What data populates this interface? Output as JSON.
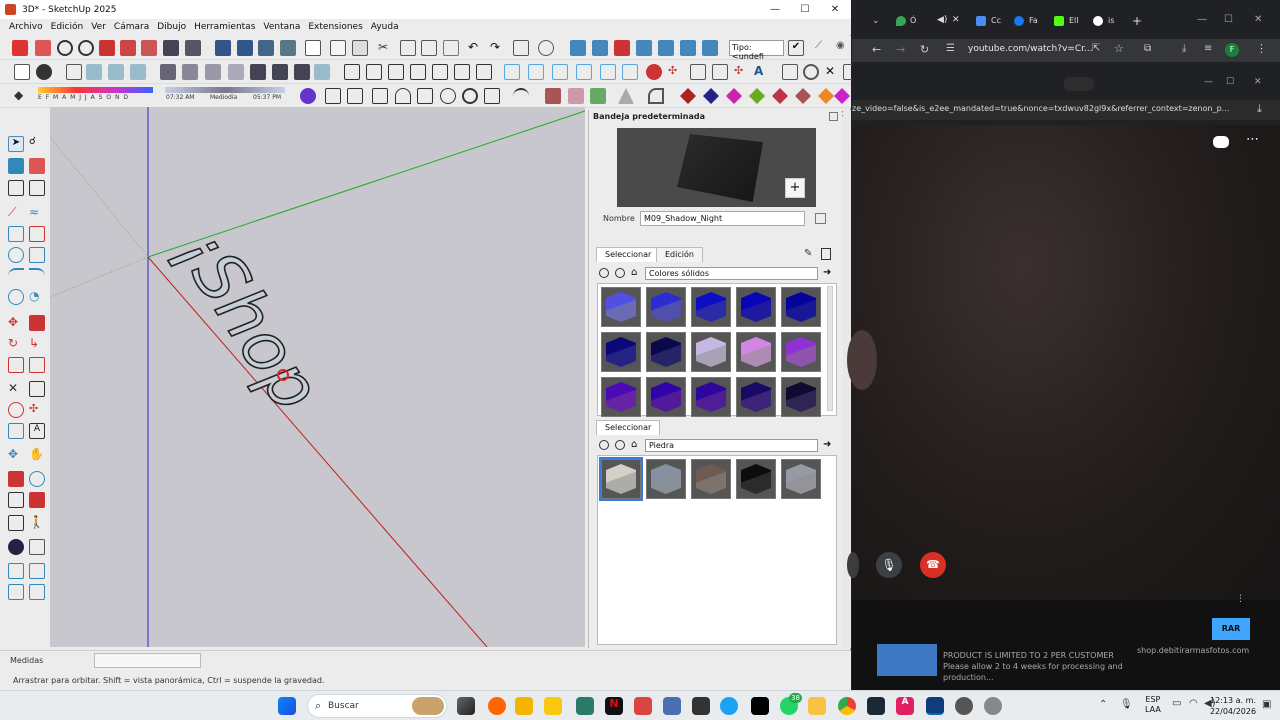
{
  "sketchup": {
    "title": "3D* - SketchUp 2025",
    "menu": [
      "Archivo",
      "Edición",
      "Ver",
      "Cámara",
      "Dibujo",
      "Herramientas",
      "Ventana",
      "Extensiones",
      "Ayuda"
    ],
    "tipo_label": "Tipo: <undefi",
    "months": "E F M A M J J A S O N D",
    "time_start": "07:32 AM",
    "time_mid": "Mediodía",
    "time_end": "05:37 PM",
    "viewport_text": "¡Shop",
    "status_measure_label": "Medidas",
    "status_hint": "Arrastrar para orbitar. Shift = vista panorámica, Ctrl = suspende la gravedad."
  },
  "tray": {
    "header": "Bandeja predeterminada",
    "name_label": "Nombre",
    "name_value": "M09_Shadow_Night",
    "tab_select": "Seleccionar",
    "tab_edit": "Edición",
    "collection_1": "Colores sólidos",
    "section2_tab": "Seleccionar",
    "collection_2": "Piedra",
    "swatches_solid": [
      "#8f8ff0",
      "#6a6ae8",
      "#3a3ae0",
      "#2a22d8",
      "#2020c8",
      "#3030b0",
      "#33308a",
      "#e0d8f0",
      "#e8b8f0",
      "#c070e8",
      "#8a30d8",
      "#7020d0",
      "#6a28c8",
      "#5030a0",
      "#403070"
    ],
    "swatches_stone": [
      "#e8e6e0",
      "#b8c0cc",
      "#a89890",
      "#3a3a3a",
      "#c4c6cc"
    ]
  },
  "browser": {
    "url": "youtube.com/watch?v=Cr...",
    "url_ext": "ze_video=false&is_e2ee_mandated=true&nonce=txdwuv82gl9x&referrer_context=zenon_p...",
    "tabs": [
      "Ó",
      "Cc",
      "Fa",
      "Ell",
      "is"
    ],
    "ad_text": "PRODUCT IS LIMITED TO 2 PER CUSTOMER Please allow 2 to 4 weeks for processing and production...",
    "ad_domain": "shop.debitirarmasfotos.com",
    "ad_button": "RAR"
  },
  "taskbar": {
    "search_label": "Buscar",
    "lang": "ESP",
    "lang2": "LAA",
    "time": "12:13 a. m.",
    "date": "22/04/2026",
    "badge": "38"
  },
  "colors": {
    "viewport": "#c7c7cd",
    "accent_red": "#d93025",
    "taskbar": "#e8ecef"
  }
}
